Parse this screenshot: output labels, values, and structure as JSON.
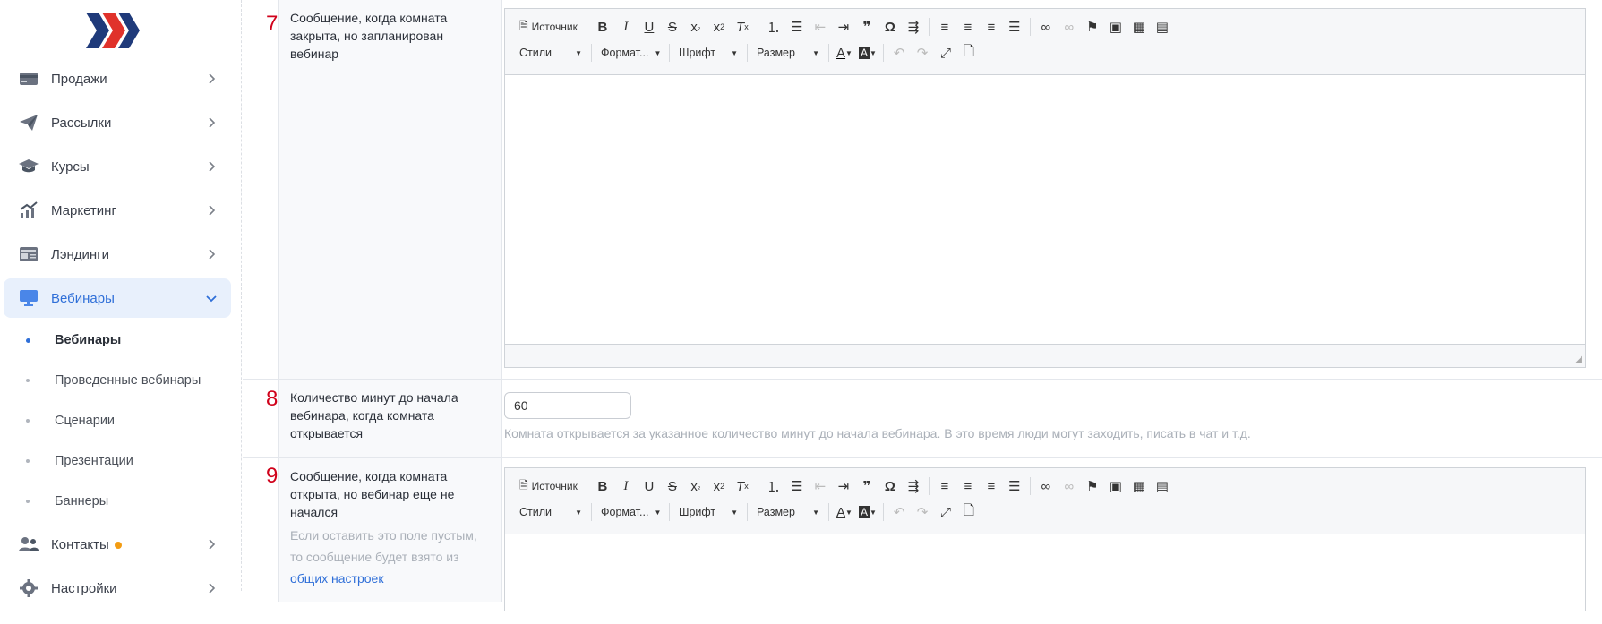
{
  "colors": {
    "accent": "#2f6fd8",
    "number": "#d0021b",
    "badge": "#f39c12",
    "logo_dark": "#1f3a7a",
    "logo_red": "#e0322b"
  },
  "sidebar": {
    "items": [
      {
        "label": "Продажи",
        "icon": "wallet-icon"
      },
      {
        "label": "Рассылки",
        "icon": "paper-plane-icon"
      },
      {
        "label": "Курсы",
        "icon": "graduation-cap-icon"
      },
      {
        "label": "Маркетинг",
        "icon": "chart-growth-icon"
      },
      {
        "label": "Лэндинги",
        "icon": "landing-page-icon"
      },
      {
        "label": "Вебинары",
        "icon": "monitor-icon"
      }
    ],
    "subitems": [
      {
        "label": "Вебинары"
      },
      {
        "label": "Проведенные вебинары"
      },
      {
        "label": "Сценарии"
      },
      {
        "label": "Презентации"
      },
      {
        "label": "Баннеры"
      }
    ],
    "contacts": {
      "label": "Контакты",
      "icon": "users-icon"
    },
    "settings": {
      "label": "Настройки",
      "icon": "gear-icon"
    }
  },
  "toolbar": {
    "source_label": "Источник",
    "combos": [
      "Стили",
      "Формат...",
      "Шрифт",
      "Размер"
    ]
  },
  "rows": {
    "r7": {
      "num": "7",
      "label": "Сообщение, когда комната закрыта, но запланирован вебинар"
    },
    "r8": {
      "num": "8",
      "label": "Количество минут до начала вебинара, когда комната открывается",
      "value": "60",
      "help": "Комната открывается за указанное количество минут до начала вебинара. В это время люди могут заходить, писать в чат и т.д."
    },
    "r9": {
      "num": "9",
      "label": "Сообщение, когда комната открыта, но вебинар еще не начался",
      "hint": "Если оставить это поле пустым, то сообщение будет взято из",
      "hint_link": "общих настроек"
    }
  }
}
